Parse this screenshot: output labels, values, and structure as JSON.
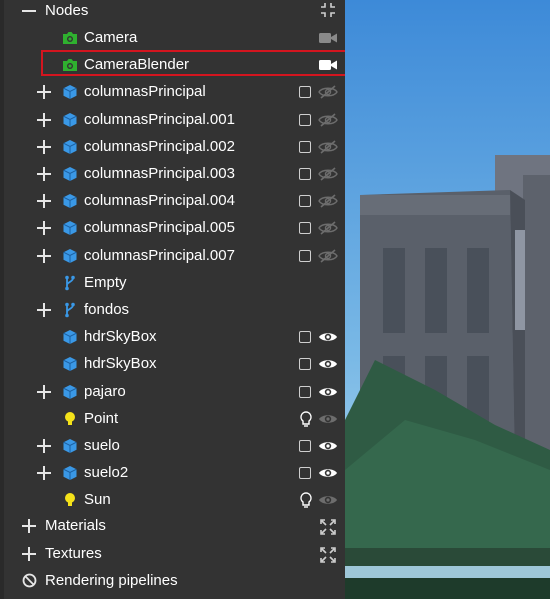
{
  "tree": {
    "nodes_header": {
      "label": "Nodes",
      "collapse_icon": "compress-icon"
    },
    "nodes": [
      {
        "label": "Camera",
        "icon": "camera-icon",
        "icon_color": "#2fb12f",
        "expand": "none",
        "right": "camera-recorder-icon",
        "active": false,
        "selected": false
      },
      {
        "label": "CameraBlender",
        "icon": "camera-icon",
        "icon_color": "#2fb12f",
        "expand": "none",
        "right": "camera-recorder-icon",
        "active": true,
        "selected": true
      },
      {
        "label": "columnasPrincipal",
        "icon": "cube-icon",
        "icon_color": "#3a98e6",
        "expand": "plus",
        "checkbox": true,
        "visibility": "eye-slash-icon"
      },
      {
        "label": "columnasPrincipal.001",
        "icon": "cube-icon",
        "icon_color": "#3a98e6",
        "expand": "plus",
        "checkbox": true,
        "visibility": "eye-slash-icon"
      },
      {
        "label": "columnasPrincipal.002",
        "icon": "cube-icon",
        "icon_color": "#3a98e6",
        "expand": "plus",
        "checkbox": true,
        "visibility": "eye-slash-icon"
      },
      {
        "label": "columnasPrincipal.003",
        "icon": "cube-icon",
        "icon_color": "#3a98e6",
        "expand": "plus",
        "checkbox": true,
        "visibility": "eye-slash-icon"
      },
      {
        "label": "columnasPrincipal.004",
        "icon": "cube-icon",
        "icon_color": "#3a98e6",
        "expand": "plus",
        "checkbox": true,
        "visibility": "eye-slash-icon"
      },
      {
        "label": "columnasPrincipal.005",
        "icon": "cube-icon",
        "icon_color": "#3a98e6",
        "expand": "plus",
        "checkbox": true,
        "visibility": "eye-slash-icon"
      },
      {
        "label": "columnasPrincipal.007",
        "icon": "cube-icon",
        "icon_color": "#3a98e6",
        "expand": "plus",
        "checkbox": true,
        "visibility": "eye-slash-icon"
      },
      {
        "label": "Empty",
        "icon": "branch-icon",
        "icon_color": "#3a98e6",
        "expand": "none"
      },
      {
        "label": "fondos",
        "icon": "branch-icon",
        "icon_color": "#3a98e6",
        "expand": "plus"
      },
      {
        "label": "hdrSkyBox",
        "icon": "cube-icon",
        "icon_color": "#3a98e6",
        "expand": "none",
        "checkbox": true,
        "visibility": "eye-icon"
      },
      {
        "label": "hdrSkyBox",
        "icon": "cube-icon",
        "icon_color": "#3a98e6",
        "expand": "none",
        "checkbox": true,
        "visibility": "eye-icon"
      },
      {
        "label": "pajaro",
        "icon": "cube-icon",
        "icon_color": "#3a98e6",
        "expand": "plus",
        "checkbox": true,
        "visibility": "eye-icon"
      },
      {
        "label": "Point",
        "icon": "lightbulb-icon",
        "icon_color": "#f4e21a",
        "expand": "none",
        "light": true,
        "visibility": "eye-dim-icon"
      },
      {
        "label": "suelo",
        "icon": "cube-icon",
        "icon_color": "#3a98e6",
        "expand": "plus",
        "checkbox": true,
        "visibility": "eye-icon"
      },
      {
        "label": "suelo2",
        "icon": "cube-icon",
        "icon_color": "#3a98e6",
        "expand": "plus",
        "checkbox": true,
        "visibility": "eye-icon"
      },
      {
        "label": "Sun",
        "icon": "lightbulb-icon",
        "icon_color": "#f4e21a",
        "expand": "none",
        "light": true,
        "visibility": "eye-dim-icon"
      }
    ],
    "sections": [
      {
        "label": "Materials",
        "expand": "plus",
        "right": "expand-arrows-icon"
      },
      {
        "label": "Textures",
        "expand": "plus",
        "right": "expand-arrows-icon"
      },
      {
        "label": "Rendering pipelines",
        "expand": "ban",
        "right": ""
      }
    ]
  },
  "colors": {
    "panel_bg": "#333333",
    "highlight_border": "#d4151f",
    "sky_top": "#3f8cd9",
    "sky_bottom": "#a6d2ea",
    "ground": "#2f5b44"
  }
}
